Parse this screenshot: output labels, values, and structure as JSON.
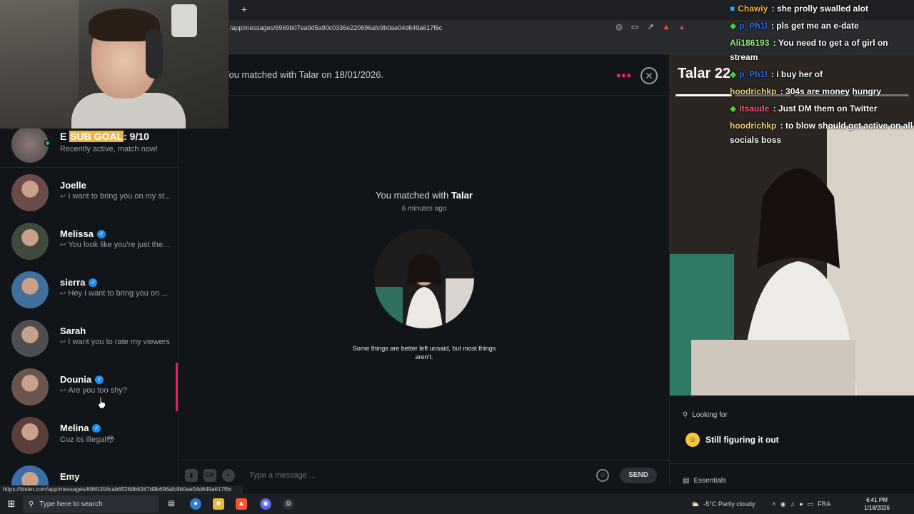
{
  "browser": {
    "new_tab": "+",
    "url": "/app/messages/6969b07ea9d5a90c0336e220696afc9b0ae04d649a617f6c",
    "status_url": "https://tinder.com/app/messages/6965356cab6ff268b6347d9b696afc9b0ae04d649a617f6c"
  },
  "overlay": {
    "sub_goal_prefix": "E",
    "sub_goal_hl": "SUB GOAL",
    "sub_goal_rest": ": 9/10",
    "recently_active": "Recently active, match now!"
  },
  "sidebar": {
    "conversations": [
      {
        "name": "Joelle",
        "snippet": "I want to bring you on my st...",
        "verified": false,
        "reply": true,
        "avatar_color": "#6b4a4a"
      },
      {
        "name": "Melissa",
        "snippet": "You look like you're just the...",
        "verified": true,
        "reply": true,
        "avatar_color": "#3f4a3c"
      },
      {
        "name": "sierra",
        "snippet": "Hey I want to bring you on ...",
        "verified": true,
        "reply": true,
        "avatar_color": "#3f6f9a"
      },
      {
        "name": "Sarah",
        "snippet": "I want you to rate my viewers",
        "verified": false,
        "reply": true,
        "avatar_color": "#4d4d52"
      },
      {
        "name": "Dounia",
        "snippet": "Are you too shy?",
        "verified": true,
        "reply": true,
        "avatar_color": "#6a554c"
      },
      {
        "name": "Melina",
        "snippet": "Cuz its illegal😳",
        "verified": true,
        "reply": false,
        "avatar_color": "#5a3e3a"
      },
      {
        "name": "Emy",
        "snippet": "",
        "verified": false,
        "reply": false,
        "avatar_color": "#3a6ea8"
      }
    ]
  },
  "chat": {
    "matched_header": "You matched with Talar on 18/01/2026.",
    "match_prefix": "You matched with",
    "match_name": "Talar",
    "match_time": "6 minutes ago",
    "quote": "Some things are better left unsaid, but most things aren't.",
    "composer": {
      "gif": "GIF",
      "placeholder": "Type a message ...",
      "send": "SEND"
    }
  },
  "profile": {
    "name": "Talar 22",
    "looking_for_label": "Looking for",
    "looking_for_value": "Still figuring it out",
    "essentials_label": "Essentials"
  },
  "stream_chat": [
    {
      "user": "Chawiy",
      "color": "#f3b53a",
      "badge": "b",
      "text": "she prolly swalled alot"
    },
    {
      "user": "p_Ph1l",
      "color": "#2f6fe8",
      "badge": "g",
      "text": "pls get me an e-date"
    },
    {
      "user": "Ali186193",
      "color": "#8ef07a",
      "badge": "",
      "text": "You need to get a of girl on stream"
    },
    {
      "user": "p_Ph1l",
      "color": "#2f6fe8",
      "badge": "g",
      "text": "i buy her of"
    },
    {
      "user": "hoodrichkp",
      "color": "#f0d27a",
      "badge": "",
      "text": "304s are money hungry"
    },
    {
      "user": "itsaude",
      "color": "#ff5a8a",
      "badge": "g",
      "text": "Just DM them on Twitter"
    },
    {
      "user": "hoodrichkp",
      "color": "#f0d27a",
      "badge": "",
      "text": "to blow should get active on all socials boss"
    }
  ],
  "taskbar": {
    "search_placeholder": "Type here to search",
    "weather": "-5°C  Partly cloudy",
    "lang": "FRA",
    "time": "6:41 PM",
    "date": "1/18/2026"
  }
}
